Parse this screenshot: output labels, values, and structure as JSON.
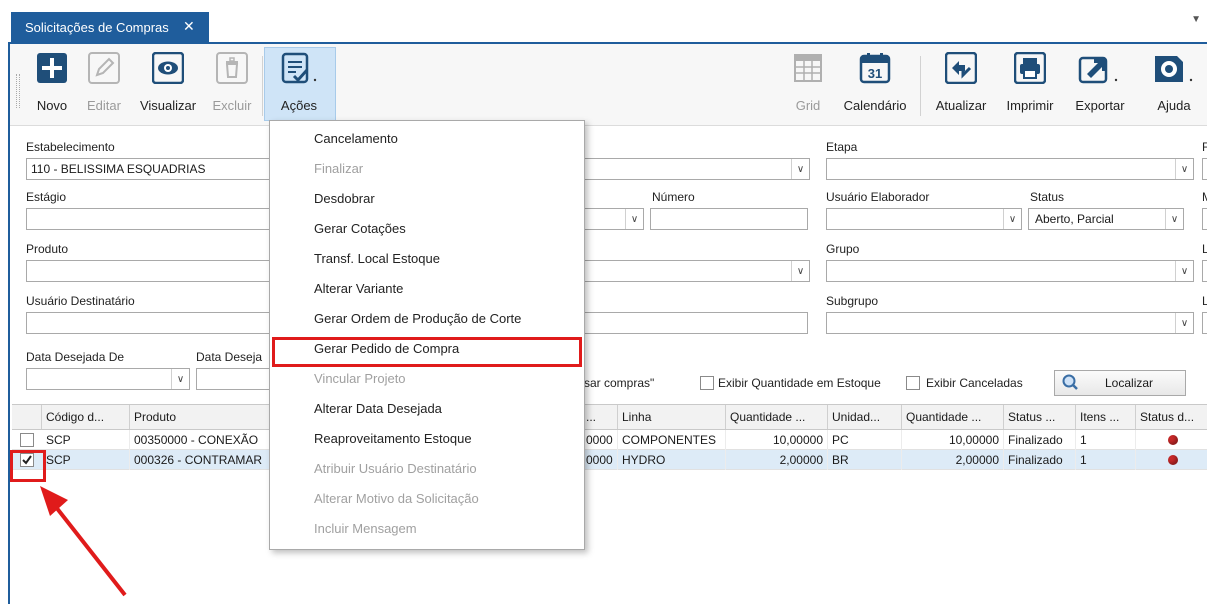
{
  "tab": {
    "title": "Solicitações de Compras",
    "close": "✕"
  },
  "toolbar": {
    "novo": "Novo",
    "editar": "Editar",
    "visualizar": "Visualizar",
    "excluir": "Excluir",
    "acoes": "Ações",
    "grid": "Grid",
    "calendario": "Calendário",
    "calendar_day": "31",
    "atualizar": "Atualizar",
    "imprimir": "Imprimir",
    "exportar": "Exportar",
    "ajuda": "Ajuda"
  },
  "filters": {
    "estabelecimento_label": "Estabelecimento",
    "estabelecimento_value": "110 - BELISSIMA ESQUADRIAS",
    "etapa_label": "Etapa",
    "estagio_label": "Estágio",
    "numero_label": "Número",
    "usuario_elaborador_label": "Usuário Elaborador",
    "status_label": "Status",
    "status_value": "Aberto, Parcial",
    "produto_label": "Produto",
    "grupo_label": "Grupo",
    "usuario_destinatario_label": "Usuário Destinatário",
    "subgrupo_label": "Subgrupo",
    "data_desejada_de_label": "Data Desejada De",
    "data_desejada_ate_label": "Data Deseja",
    "right_labels": [
      "F",
      "M",
      "Li",
      "Lo"
    ],
    "compras_fragment": "sar compras\"",
    "exibir_quantidade_estoque": "Exibir Quantidade em Estoque",
    "exibir_canceladas": "Exibir Canceladas",
    "localizar": "Localizar"
  },
  "grid": {
    "columns": [
      "Código d...",
      "Produto",
      "...",
      "Linha",
      "Quantidade ...",
      "Unidad...",
      "Quantidade ...",
      "Status ...",
      "Itens ...",
      "Status d..."
    ],
    "rows": [
      {
        "checked": false,
        "codigo": "SCP",
        "produto": "00350000 - CONEXÃO",
        "frag": "0000",
        "linha": "COMPONENTES",
        "quantidade": "10,00000",
        "unidade": "PC",
        "quantidade2": "10,00000",
        "status": "Finalizado",
        "itens": "1"
      },
      {
        "checked": true,
        "codigo": "SCP",
        "produto": "000326 - CONTRAMAR",
        "frag": "0000",
        "linha": "HYDRO",
        "quantidade": "2,00000",
        "unidade": "BR",
        "quantidade2": "2,00000",
        "status": "Finalizado",
        "itens": "1"
      }
    ]
  },
  "menu": {
    "items": [
      {
        "label": "Cancelamento",
        "enabled": true
      },
      {
        "label": "Finalizar",
        "enabled": false
      },
      {
        "label": "Desdobrar",
        "enabled": true
      },
      {
        "label": "Gerar Cotações",
        "enabled": true
      },
      {
        "label": "Transf. Local Estoque",
        "enabled": true
      },
      {
        "label": "Alterar Variante",
        "enabled": true
      },
      {
        "label": "Gerar Ordem de Produção de Corte",
        "enabled": true
      },
      {
        "label": "Gerar Pedido de Compra",
        "enabled": true
      },
      {
        "label": "Vincular Projeto",
        "enabled": false
      },
      {
        "label": "Alterar Data Desejada",
        "enabled": true
      },
      {
        "label": "Reaproveitamento Estoque",
        "enabled": true
      },
      {
        "label": "Atribuir Usuário Destinatário",
        "enabled": false
      },
      {
        "label": "Alterar Motivo da Solicitação",
        "enabled": false
      },
      {
        "label": "Incluir Mensagem",
        "enabled": false
      }
    ]
  },
  "colors": {
    "accent": "#1f5d9c",
    "highlight": "#e01b1b",
    "status_dot": "#c62828"
  }
}
